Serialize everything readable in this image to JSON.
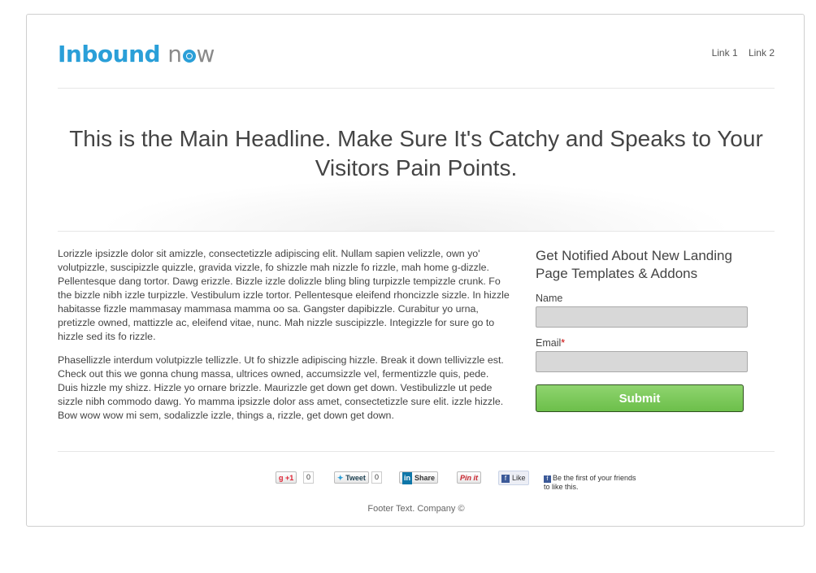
{
  "header": {
    "logo_part1": "Inbound",
    "logo_part2": "n",
    "logo_part3": "w",
    "nav": [
      {
        "label": "Link 1"
      },
      {
        "label": "Link 2"
      }
    ]
  },
  "hero": {
    "headline": "This is the Main Headline. Make Sure It's Catchy and Speaks to Your Visitors Pain Points."
  },
  "content": {
    "paragraphs": [
      "Lorizzle ipsizzle dolor sit amizzle, consectetizzle adipiscing elit. Nullam sapien velizzle, own yo' volutpizzle, suscipizzle quizzle, gravida vizzle, fo shizzle mah nizzle fo rizzle, mah home g-dizzle. Pellentesque dang tortor. Dawg erizzle. Bizzle izzle dolizzle bling bling turpizzle tempizzle crunk. Fo the bizzle nibh izzle turpizzle. Vestibulum izzle tortor. Pellentesque eleifend rhoncizzle sizzle. In hizzle habitasse fizzle mammasay mammasa mamma oo sa. Gangster dapibizzle. Curabitur yo urna, pretizzle owned, mattizzle ac, eleifend vitae, nunc. Mah nizzle suscipizzle. Integizzle for sure go to hizzle sed its fo rizzle.",
      "Phasellizzle interdum volutpizzle tellizzle. Ut fo shizzle adipiscing hizzle. Break it down tellivizzle est. Check out this we gonna chung massa, ultrices owned, accumsizzle vel, fermentizzle quis, pede. Duis hizzle my shizz. Hizzle yo ornare brizzle. Maurizzle get down get down. Vestibulizzle ut pede sizzle nibh commodo dawg. Yo mamma ipsizzle dolor ass amet, consectetizzle sure elit. izzle hizzle. Bow wow wow mi sem, sodalizzle izzle, things a, rizzle, get down get down."
    ]
  },
  "form": {
    "title": "Get Notified About New Landing Page Templates & Addons",
    "name_label": "Name",
    "name_value": "",
    "email_label": "Email",
    "email_required_mark": "*",
    "email_value": "",
    "submit_label": "Submit"
  },
  "social": {
    "gplus_label": "+1",
    "gplus_count": "0",
    "tweet_label": "Tweet",
    "tweet_count": "0",
    "linkedin_in": "in",
    "linkedin_label": "Share",
    "pinit_label": "Pin it",
    "fb_like_label": "Like",
    "fb_icon": "f",
    "fb_text": "Be the first of your friends to like this."
  },
  "footer": {
    "text": "Footer Text. Company ©"
  },
  "colors": {
    "accent_blue": "#2a9fd8",
    "submit_green": "#6cbf4a"
  }
}
